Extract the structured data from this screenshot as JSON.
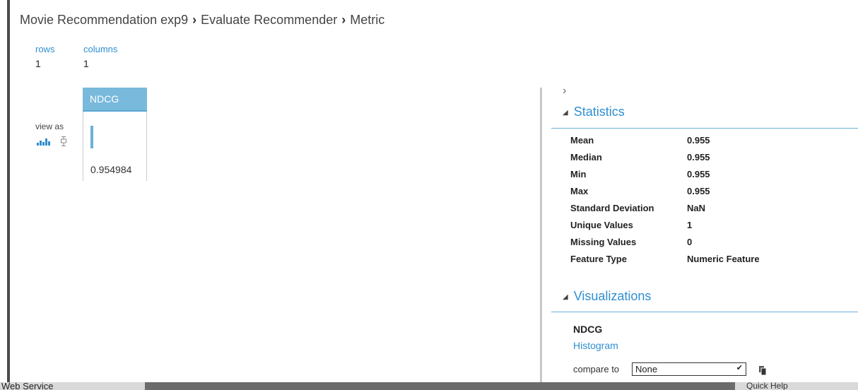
{
  "breadcrumb": {
    "items": [
      "Movie Recommendation exp9",
      "Evaluate Recommender",
      "Metric"
    ],
    "separator": "›"
  },
  "dataset": {
    "rows_label": "rows",
    "rows_value": "1",
    "columns_label": "columns",
    "columns_value": "1"
  },
  "view_as": {
    "label": "view as",
    "options": [
      "histogram-icon",
      "boxplot-icon"
    ]
  },
  "table": {
    "column_header": "NDCG",
    "cell_value": "0.954984"
  },
  "panel": {
    "chevron": "›",
    "statistics_title": "Statistics",
    "statistics": [
      {
        "name": "Mean",
        "value": "0.955"
      },
      {
        "name": "Median",
        "value": "0.955"
      },
      {
        "name": "Min",
        "value": "0.955"
      },
      {
        "name": "Max",
        "value": "0.955"
      },
      {
        "name": "Standard Deviation",
        "value": "NaN"
      },
      {
        "name": "Unique Values",
        "value": "1"
      },
      {
        "name": "Missing Values",
        "value": "0"
      },
      {
        "name": "Feature Type",
        "value": "Numeric Feature"
      }
    ],
    "visualizations_title": "Visualizations",
    "vis_column": "NDCG",
    "vis_link": "Histogram",
    "compare_label": "compare to",
    "compare_selected": "None"
  },
  "footer": {
    "left_text": "Web Service",
    "right_text": "Quick Help"
  },
  "colors": {
    "accent": "#2f8fd0",
    "header_fill": "#79b9dc"
  }
}
